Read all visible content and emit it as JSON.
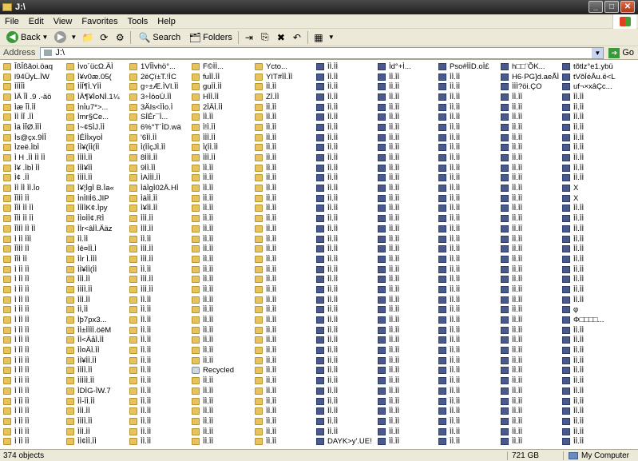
{
  "window": {
    "title": "J:\\",
    "buttons": [
      "_",
      "□",
      "✕"
    ]
  },
  "menu": [
    "File",
    "Edit",
    "View",
    "Favorites",
    "Tools",
    "Help"
  ],
  "toolbar": {
    "back": "Back",
    "search": "Search",
    "folders": "Folders"
  },
  "address": {
    "label": "Address",
    "value": "J:\\",
    "go": "Go"
  },
  "columns": [
    [
      "ÎßÎßãoi.öaq",
      "l94ÜyL.ÌW",
      "ÌÏÌÎÌ",
      "ÌÄ ÎÌ .9 .-äö",
      "Ìæ ÎÌ.ÌÌ",
      "ÌÌ ÌÎ .ÌÌ",
      "Ìä ÌÎØ.ÌÌÌ",
      "Ìs@çx.9ÌÎ",
      "Ìzeë.ÌbÌ",
      "Ì H .ÌÌ ÌÌ ÌÌ",
      "Ì¥ .ÌbÌ ÌÌ",
      "Ì¢ .ÌÌ",
      "ÌÌ ÌÌ ÌÌ.Ìo",
      "ÎÌÌÌ ÌÌ",
      "ÎÌÌ ÌÌ ÌÌ",
      "ÎÌÌ ÌÌ ÌÌ",
      "ÎÌÌÌ ÌÌ ÌÌ",
      "Ì ÌÌ ÌÌÌ",
      "ÎÌÌÌ ÌÌ",
      "ÎÌÌ ÌÌ",
      "Ì ÌÌ ÌÌ",
      "Ì ÌÌ ÌÌ",
      "Ì ÌÌ ÌÌ",
      "Ì ÌÌ ÌÌ",
      "Ì ÌÌ ÌÌ",
      "Ì ÌÌ ÌÌ",
      "Ì ÌÌ ÌÌ",
      "Ì ÌÌ ÌÌ",
      "Ì ÌÌ ÌÌ",
      "Ì ÌÌ ÌÌ",
      "Ì ÌÌ ÌÌ",
      "Ì ÌÌ ÌÌ",
      "Ì ÌÌ ÌÌ",
      "Ì ÌÌ ÌÌ",
      "Ì ÌÌ ÌÌ",
      "Ì ÌÌ ÌÌ",
      "Ì ÌÌ ÌÌ",
      "Ì ÌÌ ÌÌ"
    ],
    [
      "Ìvo´ücΩ.ÄÌ",
      "Ì¥v0æ.05(",
      "ÌÌÎ¶Ì.YÌÌ",
      "ÌÄ¶¥ÌoNÌ.1¼",
      "ÌnÌu7*>...",
      "Ìmr§Ce...",
      "Ì~¢5ÌJ.ÌÌ",
      "ÌÉÌÌxyoÌ",
      "ÌÌ¥(ÌÌ(ÌÌ",
      "ÌÌÌÌ.ÌÌ",
      "ÌÌÌ¥ÌÌ",
      "ÌÌÌÌ.ÌÌ",
      "Ì¥¦ÌgÌ B.Ìa«",
      "ÌnÌIlÌ6.JIP",
      "ÌÌÌÌK¢.Ìpy",
      "ÌÌ¤ÌÌ¢.RÌ",
      "ÌÌr<âÌÌ.Ääz",
      "ÌÌ.ÌÌ",
      "Ìê¤ÌÌ.Ì",
      "ÌÌr Ì.ÌÌÌ",
      "ÌÌ¥ÌÌ(ÌÌ",
      "ÌÌÌ.ÌÌ",
      "ÌÌÌÌ.ÌÌ",
      "ÌÌÌ.ÌÌ",
      "ÌÌ,ÌÌ",
      "Ìþ7px3...",
      "ÌÌ±ÌÌÌÌ.öêM",
      "ÌÌ<ÄåÌ.ÌÌ",
      "ÌÌ¤ÄÌ.ÌÌ",
      "ÌÌ¥ÌÌ.ÌÌ",
      "ÌÌÌÌ.ÌÌ",
      "ÌÌÌÌÌ.ÌÌ",
      "ÌDÌG-ÌW.7",
      "ÌÌ-ÌÌ.ÌÌ",
      "ÌÌÌ.ÌÌ",
      "ÌÌÌÌ.ÌÌ",
      "ÌÌÌ.ÌÌ",
      "ÌÌ¢ÌÌ.ÌÌ"
    ],
    [
      "1VÎÌvhö°...",
      "2ëÇï±T.!ÌC",
      "g÷±Æ.ÌVI.ÌÌ",
      "3÷ÌöoÚ.ÌÌ",
      "3ÄIs<ÌÌo.Ì",
      "SÍÉr¯Ì...",
      "6%°T´ÌD.wä",
      "'6ÌÌ.ÌÌ",
      "Ì(ÌÌçJÌ.ÌÌ",
      "8ÌÌÌ.ÌÌ",
      "9ÌÌ.ÌÌ",
      "ÌAÌÌÌ.ÌÌ",
      "ÌäÌgÌ02Ä.HÌ",
      "ÌäÌÌ.ÌÌ",
      "Ì¥ÌÌ.ÌÌ",
      "ÌÌÌ.ÌÌ",
      "ÌÌÌ.ÌÌ",
      "ÌÌ.ÌÌ",
      "ÌÌÌ.ÌÌ",
      "ÌÌÌ.ÌÌ",
      "ÌÌ.ÌÌ",
      "ÌÌÌ.ÌÌ",
      "ÌÌÌ.ÌÌ",
      "ÌÌ.ÌÌ",
      "ÌÌ.ÌÌ",
      "ÌÌ.ÌÌ",
      "ÌÌ.ÌÌ",
      "ÌÌ.ÌÌ",
      "ÌÌ.ÌÌ",
      "ÌÌ.ÌÌ",
      "ÌÌ.ÌÌ",
      "ÌÌ.ÌÌ",
      "ÌÌ.ÌÌ",
      "ÌÌ.ÌÌ",
      "ÌÌ.ÌÌ",
      "ÌÌ.ÌÌ",
      "ÌÌ.ÌÌ",
      "ÌÌ.ÌÌ"
    ],
    [
      "F©ÌÌ...",
      "fuÌÌ.ÌÌ",
      "guÌÌ.ÌÌ",
      "HÌÌ.ÌÌ",
      "2ÌÄÌ.ÌÌ",
      "ÌÌ.ÌÌ",
      "Ì!Ì.ÌÌ",
      "ÌÌÌ.ÌÌ",
      "Ì(ÌÌ.ÌÌ",
      "ÌÌÌ.ÌÌ",
      "ÌÌ.ÌÌ",
      "ÌÌ.ÌÌ",
      "ÌÌ.ÌÌ",
      "ÌÌ.ÌÌ",
      "ÌÌ.ÌÌ",
      "ÌÌ.ÌÌ",
      "ÌÌ.ÌÌ",
      "ÌÌ.ÌÌ",
      "ÌÌ.ÌÌ",
      "ÌÌ.ÌÌ",
      "ÌÌ.ÌÌ",
      "ÌÌ.ÌÌ",
      "ÌÌ.ÌÌ",
      "ÌÌ.ÌÌ",
      "ÌÌ.ÌÌ",
      "ÌÌ.ÌÌ",
      "ÌÌ.ÌÌ",
      "ÌÌ.ÌÌ",
      "ÌÌ.ÌÌ",
      "ÌÌ.ÌÌ",
      "Recycled",
      "ÌÌ.ÌÌ",
      "ÌÌ.ÌÌ",
      "ÌÌ.ÌÌ",
      "ÌÌ.ÌÌ",
      "ÌÌ.ÌÌ",
      "ÌÌ.ÌÌ",
      "ÌÌ.ÌÌ"
    ],
    [
      "Ycto...",
      "YIT#ÌÌ.ÌÌ",
      "ÌÌ.ÌÌ",
      "ZÌ.ÌÌ",
      "ÌÌ.ÌÌ",
      "ÌÌ.ÌÌ",
      "ÌÌ.ÌÌ",
      "ÌÌ.ÌÌ",
      "ÌÌ.ÌÌ",
      "ÌÌ.ÌÌ",
      "ÌÌ.ÌÌ",
      "ÌÌ.ÌÌ",
      "ÌÌ.ÌÌ",
      "ÌÌ.ÌÌ",
      "ÌÌ.ÌÌ",
      "ÌÌ.ÌÌ",
      "ÌÌ.ÌÌ",
      "ÌÌ.ÌÌ",
      "ÌÌ.ÌÌ",
      "ÌÌ.ÌÌ",
      "ÌÌ.ÌÌ",
      "ÌÌ.ÌÌ",
      "ÌÌ.ÌÌ",
      "ÌÌ.ÌÌ",
      "ÌÌ.ÌÌ",
      "ÌÌ.ÌÌ",
      "ÌÌ.ÌÌ",
      "ÌÌ.ÌÌ",
      "ÌÌ.ÌÌ",
      "ÌÌ.ÌÌ",
      "ÌÌ.ÌÌ",
      "ÌÌ.ÌÌ",
      "ÌÌ.ÌÌ",
      "ÌÌ.ÌÌ",
      "ÌÌ.ÌÌ",
      "ÌÌ.ÌÌ",
      "ÌÌ.ÌÌ",
      "ÌÌ.ÌÌ"
    ],
    [
      "ÌÌ.ÌÌ",
      "ÌÌ.ÌÌ",
      "ÌÌ.ÌÌ",
      "ÌÌ.ÌÌ",
      "ÌÌ.ÌÌ",
      "ÌÌ.ÌÌ",
      "ÌÌ.ÌÌ",
      "ÌÌ.ÌÌ",
      "ÌÌ.ÌÌ",
      "ÌÌ.ÌÌ",
      "ÌÌ.ÌÌ",
      "ÌÌ.ÌÌ",
      "ÌÌ.ÌÌ",
      "ÌÌ.ÌÌ",
      "ÌÌ.ÌÌ",
      "ÌÌ.ÌÌ",
      "ÌÌ.ÌÌ",
      "ÌÌ.ÌÌ",
      "ÌÌ.ÌÌ",
      "ÌÌ.ÌÌ",
      "ÌÌ.ÌÌ",
      "ÌÌ.ÌÌ",
      "ÌÌ.ÌÌ",
      "ÌÌ.ÌÌ",
      "ÌÌ.ÌÌ",
      "ÌÌ.ÌÌ",
      "ÌÌ.ÌÌ",
      "ÌÌ.ÌÌ",
      "ÌÌ.ÌÌ",
      "ÌÌ.ÌÌ",
      "ÌÌ.ÌÌ",
      "ÌÌ.ÌÌ",
      "ÌÌ.ÌÌ",
      "ÌÌ.ÌÌ",
      "ÌÌ.ÌÌ",
      "ÌÌ.ÌÌ",
      "ÌÌ.ÌÌ",
      "DAYK>y'.UE!"
    ],
    [
      "Ìd°+Ì...",
      "ÌÌ.ÌÌ",
      "ÌÌ.ÌÌ",
      "ÌÌ.ÌÌ",
      "ÌÌ.ÌÌ",
      "ÌÌ.ÌÌ",
      "ÌÌ.ÌÌ",
      "ÌÌ.ÌÌ",
      "ÌÌ.ÌÌ",
      "ÌÌ.ÌÌ",
      "ÌÌ.ÌÌ",
      "ÌÌ.ÌÌ",
      "ÌÌ.ÌÌ",
      "ÌÌ.ÌÌ",
      "ÌÌ.ÌÌ",
      "ÌÌ.ÌÌ",
      "ÌÌ.ÌÌ",
      "ÌÌ.ÌÌ",
      "ÌÌ.ÌÌ",
      "ÌÌ.ÌÌ",
      "ÌÌ.ÌÌ",
      "ÌÌ.ÌÌ",
      "ÌÌ.ÌÌ",
      "ÌÌ.ÌÌ",
      "ÌÌ.ÌÌ",
      "ÌÌ.ÌÌ",
      "ÌÌ.ÌÌ",
      "ÌÌ.ÌÌ",
      "ÌÌ.ÌÌ",
      "ÌÌ.ÌÌ",
      "ÌÌ.ÌÌ",
      "ÌÌ.ÌÌ",
      "ÌÌ.ÌÌ",
      "ÌÌ.ÌÌ",
      "ÌÌ.ÌÌ",
      "ÌÌ.ÌÌ",
      "ÌÌ.ÌÌ",
      "ÌÌ.ÌÌ"
    ],
    [
      "Pso#ÌÌD.oÌ£",
      "ÌÌ.ÌÌ",
      "ÌÌ.ÌÌ",
      "ÌÌ.ÌÌ",
      "ÌÌ.ÌÌ",
      "ÌÌ.ÌÌ",
      "ÌÌ.ÌÌ",
      "ÌÌ.ÌÌ",
      "ÌÌ.ÌÌ",
      "ÌÌ.ÌÌ",
      "ÌÌ.ÌÌ",
      "ÌÌ.ÌÌ",
      "ÌÌ.ÌÌ",
      "ÌÌ.ÌÌ",
      "ÌÌ.ÌÌ",
      "ÌÌ.ÌÌ",
      "ÌÌ.ÌÌ",
      "ÌÌ.ÌÌ",
      "ÌÌ.ÌÌ",
      "ÌÌ.ÌÌ",
      "ÌÌ.ÌÌ",
      "ÌÌ.ÌÌ",
      "ÌÌ.ÌÌ",
      "ÌÌ.ÌÌ",
      "ÌÌ.ÌÌ",
      "ÌÌ.ÌÌ",
      "ÌÌ.ÌÌ",
      "ÌÌ.ÌÌ",
      "ÌÌ.ÌÌ",
      "ÌÌ.ÌÌ",
      "ÌÌ.ÌÌ",
      "ÌÌ.ÌÌ",
      "ÌÌ.ÌÌ",
      "ÌÌ.ÌÌ",
      "ÌÌ.ÌÌ",
      "ÌÌ.ÌÌ",
      "ÌÌ.ÌÌ",
      "ÌÌ.ÌÌ"
    ],
    [
      "h□□¨ÕK...",
      "H6·PG]d.aeÃÌ",
      "ÌÌÌ?öi.ÇO",
      "ÌÌ.ÌÌ",
      "ÌÌ.ÌÌ",
      "ÌÌ.ÌÌ",
      "ÌÌ.ÌÌ",
      "ÌÌ.ÌÌ",
      "ÌÌ.ÌÌ",
      "ÌÌ.ÌÌ",
      "ÌÌ.ÌÌ",
      "ÌÌ.ÌÌ",
      "ÌÌ.ÌÌ",
      "ÌÌ.ÌÌ",
      "ÌÌ.ÌÌ",
      "ÌÌ.ÌÌ",
      "ÌÌ.ÌÌ",
      "ÌÌ.ÌÌ",
      "ÌÌ.ÌÌ",
      "ÌÌ.ÌÌ",
      "ÌÌ.ÌÌ",
      "ÌÌ.ÌÌ",
      "ÌÌ.ÌÌ",
      "ÌÌ.ÌÌ",
      "ÌÌ.ÌÌ",
      "ÌÌ.ÌÌ",
      "ÌÌ.ÌÌ",
      "ÌÌ.ÌÌ",
      "ÌÌ.ÌÌ",
      "ÌÌ.ÌÌ",
      "ÌÌ.ÌÌ",
      "ÌÌ.ÌÌ",
      "ÌÌ.ÌÌ",
      "ÌÌ.ÌÌ",
      "ÌÌ.ÌÌ",
      "ÌÌ.ÌÌ",
      "ÌÌ.ÌÌ",
      "ÌÌ.ÌÌ"
    ],
    [
      "tõtlz°e1.ybü",
      "tVõÍéÂu.ë<L",
      "uf¬×xâÇc...",
      "ÌÌ.ÌÌ",
      "ÌÌ.ÌÌ",
      "ÌÌ.ÌÌ",
      "ÌÌ.ÌÌ",
      "ÌÌ.ÌÌ",
      "ÌÌ.ÌÌ",
      "ÌÌ.ÌÌ",
      "ÌÌ.ÌÌ",
      "ÌÌ.ÌÌ",
      "X",
      "X",
      "ÌÌ.ÌÌ",
      "ÌÌ.ÌÌ",
      "ÌÌ.ÌÌ",
      "ÌÌ.ÌÌ",
      "ÌÌ.ÌÌ",
      "ÌÌ.ÌÌ",
      "ÌÌ.ÌÌ",
      "ÌÌ.ÌÌ",
      "ÌÌ.ÌÌ",
      "ÌÌ.ÌÌ",
      "φ",
      "Φ□□□□...",
      "ÌÌ.ÌÌ",
      "ÌÌ.ÌÌ",
      "ÌÌ.ÌÌ",
      "ÌÌ.ÌÌ",
      "ÌÌ.ÌÌ",
      "ÌÌ.ÌÌ",
      "ÌÌ.ÌÌ",
      "ÌÌ.ÌÌ",
      "ÌÌ.ÌÌ",
      "ÌÌ.ÌÌ",
      "ÌÌ.ÌÌ",
      "ÌÌ.ÌÌ"
    ]
  ],
  "status": {
    "count": "374 objects",
    "size": "721 GB",
    "location": "My Computer"
  }
}
